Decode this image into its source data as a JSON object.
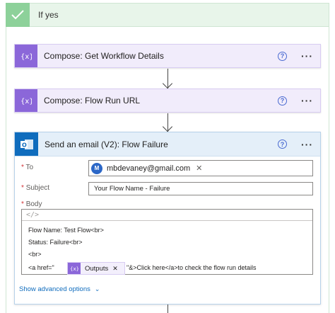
{
  "condition": {
    "label": "If yes"
  },
  "actions": [
    {
      "title": "Compose: Get Workflow Details"
    },
    {
      "title": "Compose: Flow Run URL"
    }
  ],
  "email": {
    "title": "Send an email (V2): Flow Failure",
    "to_label": "To",
    "to_value": "mbdevaney@gmail.com",
    "to_avatar": "M",
    "subject_label": "Subject",
    "subject_value": "Your Flow Name -  Failure",
    "body_label": "Body",
    "code_view": "</>",
    "body_lines": [
      "Flow Name: Test Flow<br>",
      "Status: Failure<br>",
      "<br>",
      "<a href=\"",
      "\"&>Click here</a>to check the flow run details"
    ],
    "token_label": "Outputs",
    "advanced_label": "Show advanced options"
  },
  "colors": {
    "condition_bg": "#e8f5ea",
    "check_green": "#8dd19a",
    "compose_purple": "#8b67d9",
    "compose_bg": "#f1ecfb",
    "outlook_blue": "#0f6cbd",
    "email_header_bg": "#e4eff9",
    "link_blue": "#0f6cbd"
  }
}
